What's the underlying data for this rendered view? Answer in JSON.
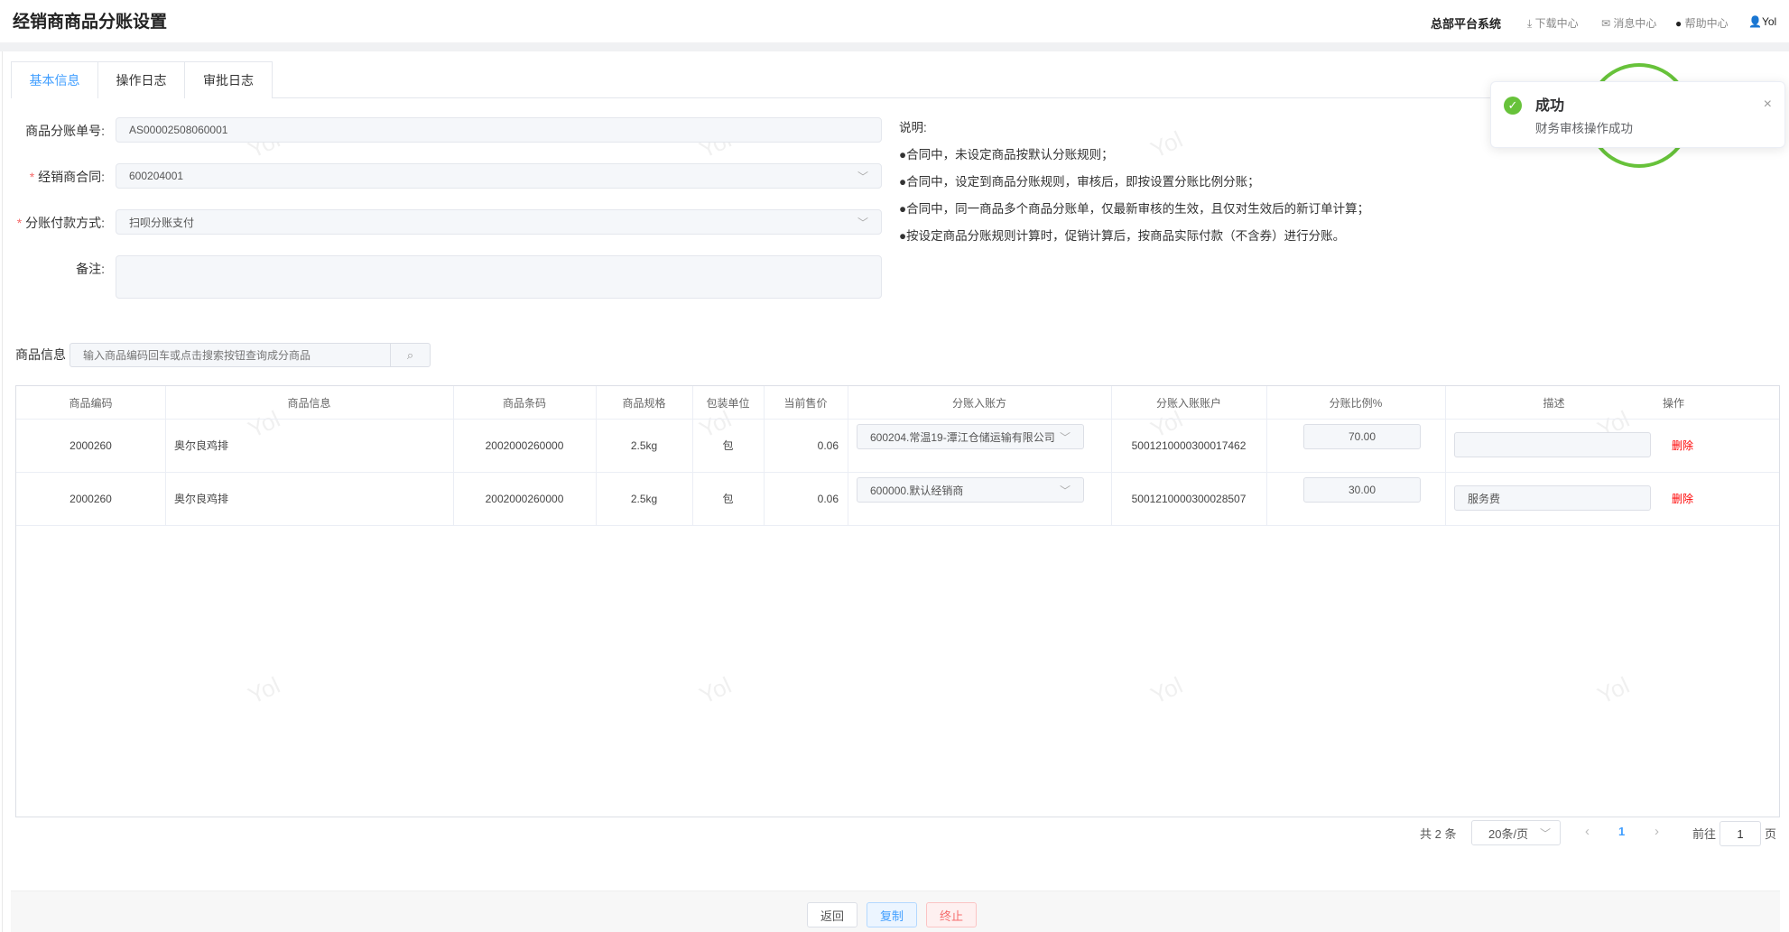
{
  "header": {
    "title": "经销商商品分账设置",
    "system": "总部平台系统",
    "download": "下载中心",
    "messages": "消息中心",
    "help": "帮助中心",
    "user": "Yol"
  },
  "tabs": [
    "基本信息",
    "操作日志",
    "审批日志"
  ],
  "form": {
    "order_no_label": "商品分账单号:",
    "order_no": "AS00002508060001",
    "contract_label": "经销商合同:",
    "contract": "600204001",
    "pay_label": "分账付款方式:",
    "pay": "扫呗分账支付",
    "remark_label": "备注:",
    "remark": ""
  },
  "notes": {
    "title": "说明:",
    "items": [
      "●合同中，未设定商品按默认分账规则；",
      "●合同中，设定到商品分账规则，审核后，即按设置分账比例分账；",
      "●合同中，同一商品多个商品分账单，仅最新审核的生效，且仅对生效后的新订单计算；",
      "●按设定商品分账规则计算时，促销计算后，按商品实际付款（不含券）进行分账。"
    ]
  },
  "goods": {
    "label": "商品信息",
    "placeholder": "输入商品编码回车或点击搜索按钮查询成分商品"
  },
  "table": {
    "columns": [
      "商品编码",
      "商品信息",
      "商品条码",
      "商品规格",
      "包装单位",
      "当前售价",
      "分账入账方",
      "分账入账账户",
      "分账比例%",
      "描述",
      "操作"
    ],
    "rows": [
      {
        "code": "2000260",
        "name": "奥尔良鸡排",
        "barcode": "2002000260000",
        "spec": "2.5kg",
        "unit": "包",
        "price": "0.06",
        "party": "600204.常温19-潭江仓储运输有限公司",
        "account": "5001210000300017462",
        "ratio": "70.00",
        "desc": "",
        "action": "删除"
      },
      {
        "code": "2000260",
        "name": "奥尔良鸡排",
        "barcode": "2002000260000",
        "spec": "2.5kg",
        "unit": "包",
        "price": "0.06",
        "party": "600000.默认经销商",
        "account": "5001210000300028507",
        "ratio": "30.00",
        "desc": "服务费",
        "action": "删除"
      }
    ]
  },
  "pagination": {
    "total": "共 2 条",
    "page_size": "20条/页",
    "current": "1",
    "goto": "前往",
    "goto_value": "1",
    "page_suffix": "页"
  },
  "footer": {
    "back": "返回",
    "copy": "复制",
    "stop": "终止"
  },
  "toast": {
    "title": "成功",
    "message": "财务审核操作成功"
  },
  "watermark": "Yol",
  "colors": {
    "primary": "#409eff",
    "danger": "#f56c6c",
    "success": "#67c23a"
  }
}
